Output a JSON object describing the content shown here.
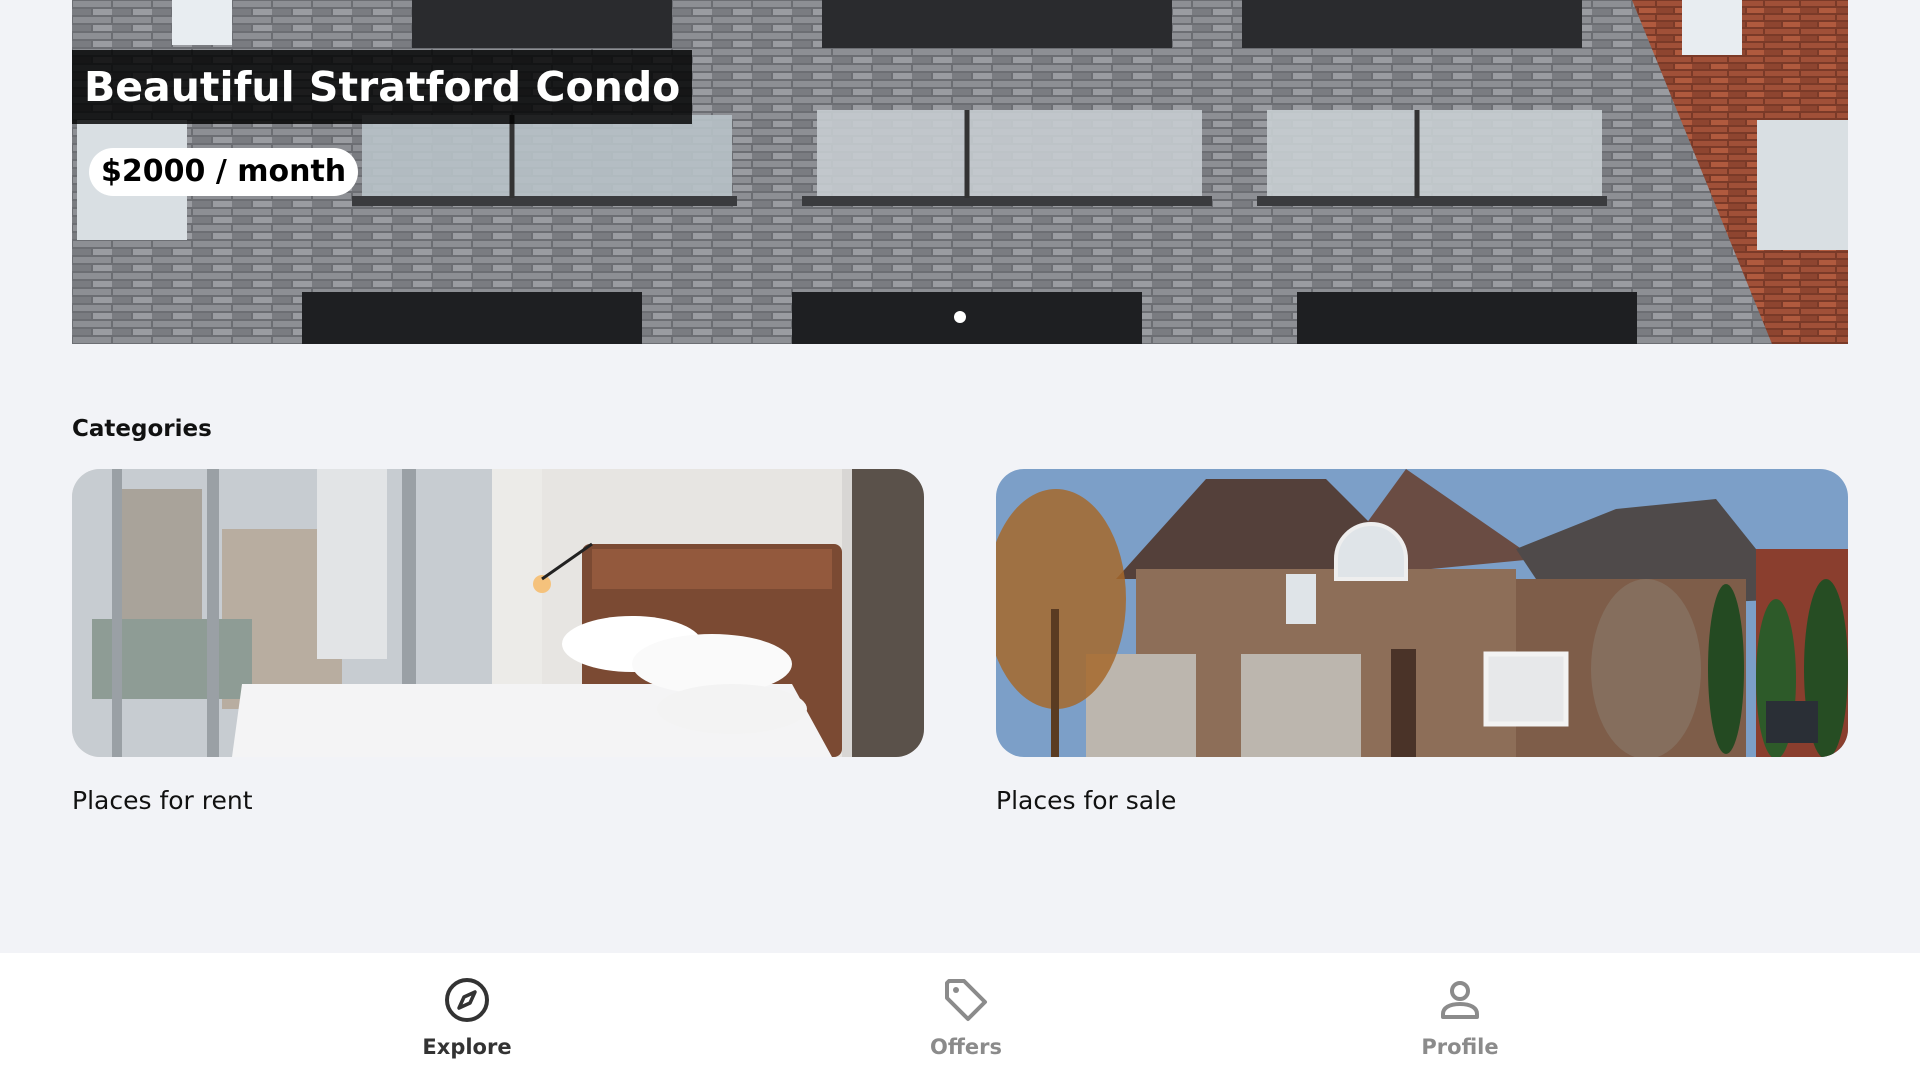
{
  "hero": {
    "title": "Beautiful Stratford Condo",
    "price": "$2000 / month",
    "slide_count": 1,
    "active_slide": 1
  },
  "categories": {
    "heading": "Categories",
    "items": [
      {
        "label": "Places for rent",
        "image": "bedroom-photo"
      },
      {
        "label": "Places for sale",
        "image": "house-photo"
      }
    ]
  },
  "bottom_nav": {
    "items": [
      {
        "label": "Explore",
        "icon": "compass-icon",
        "active": true
      },
      {
        "label": "Offers",
        "icon": "tag-icon",
        "active": false
      },
      {
        "label": "Profile",
        "icon": "person-icon",
        "active": false
      }
    ]
  },
  "colors": {
    "background": "#f2f3f7",
    "nav_background": "#ffffff",
    "nav_active": "#333333",
    "nav_inactive": "#8b8b8b"
  }
}
